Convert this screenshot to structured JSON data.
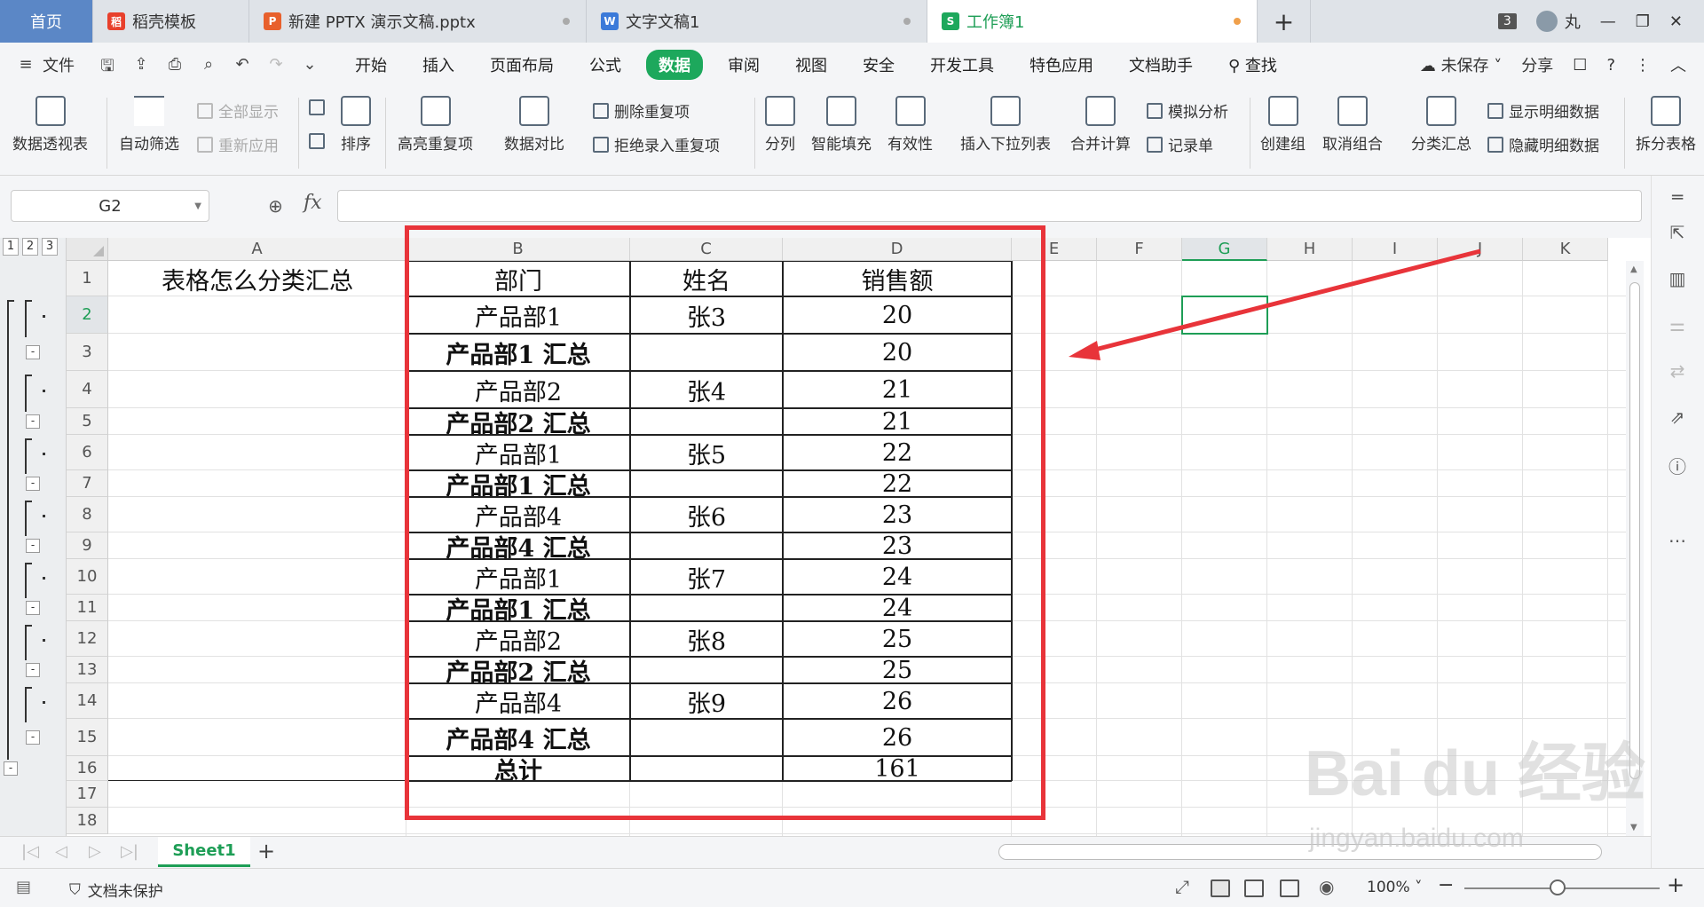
{
  "tabs": [
    {
      "label": "首页",
      "icon": "home"
    },
    {
      "label": "稻壳模板",
      "icon": "docer-icon"
    },
    {
      "label": "新建 PPTX 演示文稿.pptx",
      "icon": "ppt-icon"
    },
    {
      "label": "文字文稿1",
      "icon": "word-icon"
    },
    {
      "label": "工作簿1",
      "icon": "sheet-icon"
    }
  ],
  "tabbar_right": {
    "window_count": "3",
    "user": "丸"
  },
  "menu": {
    "file": "文件",
    "items": [
      "开始",
      "插入",
      "页面布局",
      "公式",
      "数据",
      "审阅",
      "视图",
      "安全",
      "开发工具",
      "特色应用",
      "文档助手"
    ],
    "active": "数据",
    "search": "查找",
    "unsaved": "未保存",
    "share": "分享"
  },
  "ribbon": {
    "pivot": "数据透视表",
    "autofilter": "自动筛选",
    "show_all": "全部显示",
    "reapply": "重新应用",
    "sort": "排序",
    "highlight_dup": "高亮重复项",
    "compare": "数据对比",
    "delete_dup": "删除重复项",
    "reject_dup": "拒绝录入重复项",
    "split": "分列",
    "smart_fill": "智能填充",
    "validity": "有效性",
    "insert_dropdown": "插入下拉列表",
    "merge_calc": "合并计算",
    "simulate": "模拟分析",
    "record": "记录单",
    "create_group": "创建组",
    "ungroup": "取消组合",
    "subtotal": "分类汇总",
    "show_detail": "显示明细数据",
    "hide_detail": "隐藏明细数据",
    "split_table": "拆分表格"
  },
  "formula": {
    "namebox": "G2",
    "fx": "fx",
    "value": ""
  },
  "outline_levels": [
    "1",
    "2",
    "3"
  ],
  "columns": [
    "A",
    "B",
    "C",
    "D",
    "E",
    "F",
    "G",
    "H",
    "I",
    "J",
    "K"
  ],
  "selected_col": "G",
  "rows": [
    "1",
    "2",
    "3",
    "4",
    "5",
    "6",
    "7",
    "8",
    "9",
    "10",
    "11",
    "12",
    "13",
    "14",
    "15",
    "16",
    "17",
    "18"
  ],
  "selected_row": "2",
  "table": {
    "title": "表格怎么分类汇总",
    "header": [
      "部门",
      "姓名",
      "销售额"
    ],
    "data": [
      [
        "产品部1",
        "张3",
        "20"
      ],
      [
        "产品部1 汇总",
        "",
        "20"
      ],
      [
        "产品部2",
        "张4",
        "21"
      ],
      [
        "产品部2 汇总",
        "",
        "21"
      ],
      [
        "产品部1",
        "张5",
        "22"
      ],
      [
        "产品部1 汇总",
        "",
        "22"
      ],
      [
        "产品部4",
        "张6",
        "23"
      ],
      [
        "产品部4 汇总",
        "",
        "23"
      ],
      [
        "产品部1",
        "张7",
        "24"
      ],
      [
        "产品部1 汇总",
        "",
        "24"
      ],
      [
        "产品部2",
        "张8",
        "25"
      ],
      [
        "产品部2 汇总",
        "",
        "25"
      ],
      [
        "产品部4",
        "张9",
        "26"
      ],
      [
        "产品部4 汇总",
        "",
        "26"
      ],
      [
        "总计",
        "",
        "161"
      ]
    ]
  },
  "sheet": {
    "name": "Sheet1"
  },
  "status": {
    "protect": "文档未保护",
    "zoom": "100%"
  },
  "watermark": {
    "main": "Bai du 经验",
    "url": "jingyan.baidu.com"
  },
  "colors": {
    "accent": "#1da85c",
    "highlight_box": "#e8343a",
    "home_tab": "#5b87c6"
  }
}
